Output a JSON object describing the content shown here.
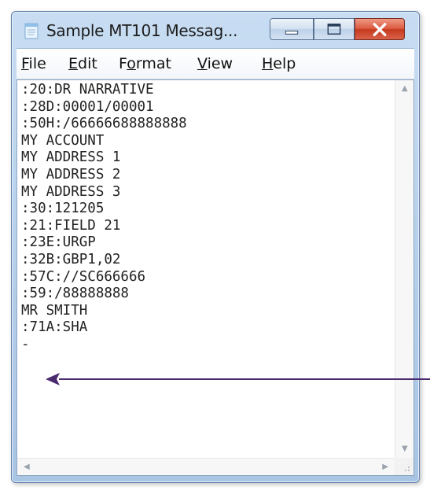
{
  "window": {
    "title": "Sample MT101 Messag..."
  },
  "menu": {
    "file": {
      "accel": "F",
      "rest": "ile"
    },
    "edit": {
      "accel": "E",
      "rest": "dit"
    },
    "format": {
      "pre": "F",
      "accel": "o",
      "rest": "rmat"
    },
    "view": {
      "accel": "V",
      "rest": "iew"
    },
    "help": {
      "accel": "H",
      "rest": "elp"
    }
  },
  "document": {
    "lines": [
      ":20:DR NARRATIVE",
      ":28D:00001/00001",
      ":50H:/66666688888888",
      "MY ACCOUNT",
      "MY ADDRESS 1",
      "MY ADDRESS 2",
      "MY ADDRESS 3",
      ":30:121205",
      ":21:FIELD 21",
      ":23E:URGP",
      ":32B:GBP1,02",
      ":57C://SC666666",
      ":59:/88888888",
      "MR SMITH",
      ":71A:SHA",
      "-"
    ]
  },
  "colors": {
    "close_button": "#d9543a",
    "arrow": "#4b2a6e",
    "title_bar": "#b9d1ea"
  }
}
